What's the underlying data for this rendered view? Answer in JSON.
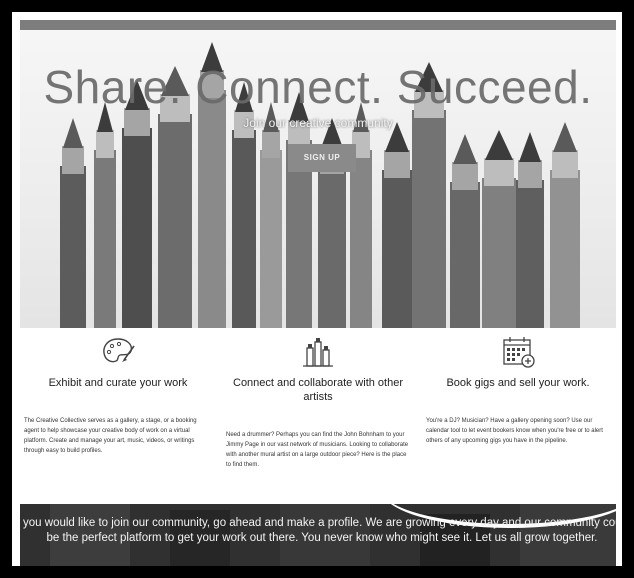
{
  "hero": {
    "title": "Share. Connect. Succeed.",
    "subtitle": "Join our creative community",
    "signup_label": "SIGN UP"
  },
  "features": [
    {
      "icon": "palette-icon",
      "title": "Exhibit and curate your work",
      "text": "The Creative Collective serves as a gallery, a stage, or a booking agent to help showcase your creative body of work on a virtual platform. Create and manage your art, music, videos, or writings through easy to build profiles."
    },
    {
      "icon": "paint-tubes-icon",
      "title": "Connect and collaborate with other artists",
      "text": "Need a drummer? Perhaps you can find the John Bohnham to your Jimmy Page in our vast network of musicians. Looking to collaborate with another mural artist on a large outdoor piece? Here is the place to find them."
    },
    {
      "icon": "calendar-icon",
      "title": "Book gigs and sell your work.",
      "text": "You're a DJ? Musician? Have a gallery opening soon? Use our calendar tool to let event bookers know when you're free or to alert others of any upcoming gigs you have in the pipeline."
    }
  ],
  "banner": {
    "text": "If you would like to join our community, go ahead and make a profile. We are growing every day and our community could be the perfect platform to get your work out there. You never know who might see it. Let us all grow together."
  },
  "colors": {
    "frame": "#000000",
    "top_bar": "#7d7d7d",
    "button": "#8a8a8a"
  }
}
